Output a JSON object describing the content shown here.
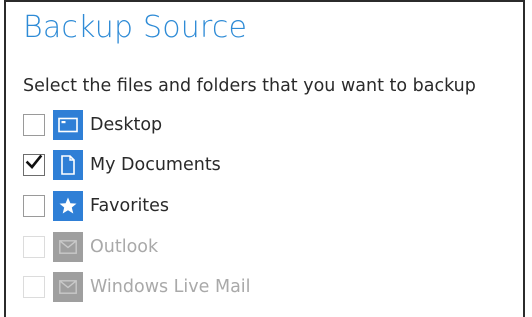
{
  "header": {
    "title": "Backup Source",
    "instruction": "Select the files and folders that you want to backup"
  },
  "sources": [
    {
      "label": "Desktop",
      "checked": false,
      "enabled": true,
      "icon": "desktop-icon"
    },
    {
      "label": "My Documents",
      "checked": true,
      "enabled": true,
      "icon": "document-icon"
    },
    {
      "label": "Favorites",
      "checked": false,
      "enabled": true,
      "icon": "star-icon"
    },
    {
      "label": "Outlook",
      "checked": false,
      "enabled": false,
      "icon": "mail-icon"
    },
    {
      "label": "Windows Live Mail",
      "checked": false,
      "enabled": false,
      "icon": "mail-icon"
    }
  ],
  "colors": {
    "accent": "#2e8bd6",
    "icon_enabled": "#2f7fd6",
    "icon_disabled": "#9f9f9f",
    "text": "#2a2a2a",
    "text_disabled": "#a9a9a9"
  }
}
